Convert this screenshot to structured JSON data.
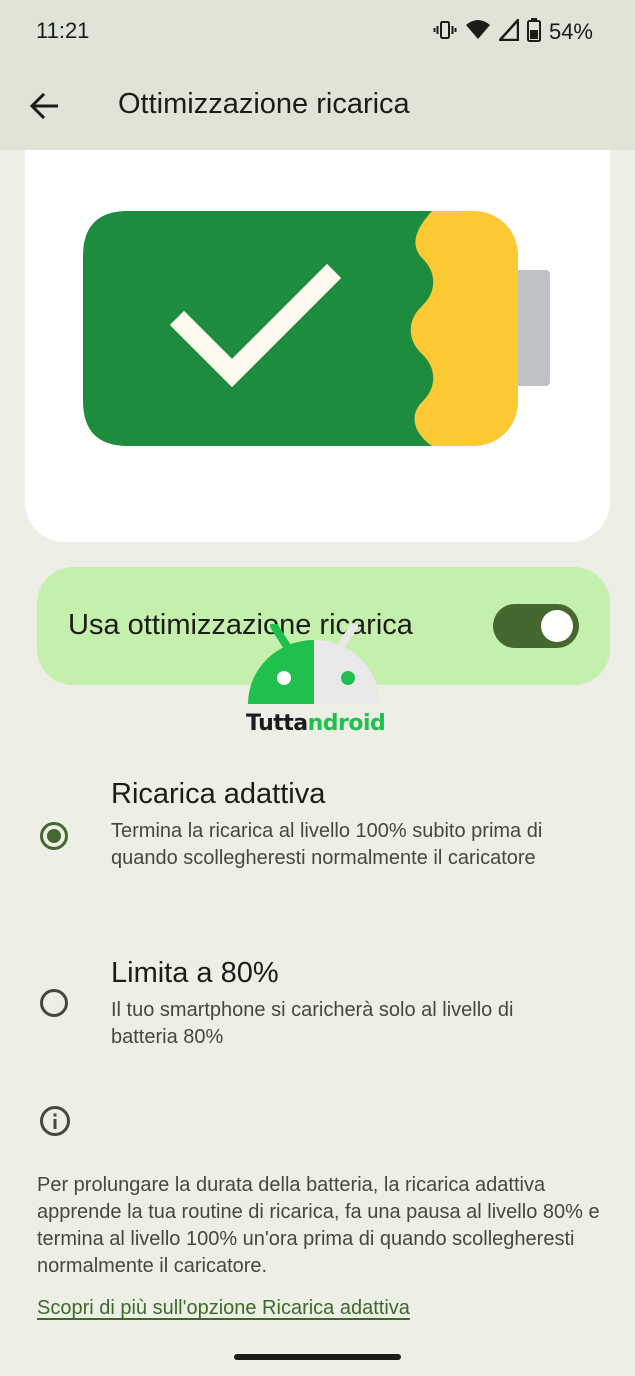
{
  "status_bar": {
    "time": "11:21",
    "battery_percent": "54%",
    "icons": [
      "vibrate-icon",
      "wifi-icon",
      "signal-icon",
      "battery-icon"
    ]
  },
  "app_bar": {
    "title": "Ottimizzazione ricarica",
    "back_icon": "arrow-back-icon"
  },
  "illustration": {
    "icon": "battery-check-illustration",
    "colors": {
      "green": "#1e8c3f",
      "yellow": "#fcc934",
      "terminal": "#bec1c6",
      "check": "#fdf9ee"
    }
  },
  "main_toggle": {
    "label": "Usa ottimizzazione ricarica",
    "state": "on"
  },
  "watermark": {
    "part1": "Tutta",
    "part2": "ndroid"
  },
  "options": [
    {
      "title": "Ricarica adattiva",
      "description": "Termina la ricarica al livello 100% subito prima di quando scollegheresti normalmente il caricatore",
      "selected": true
    },
    {
      "title": "Limita a 80%",
      "description": "Il tuo smartphone si caricherà solo al livello di batteria 80%",
      "selected": false
    }
  ],
  "info": {
    "icon": "info-icon",
    "text": "Per prolungare la durata della batteria, la ricarica adattiva apprende la tua routine di ricarica, fa una pausa al livello 80% e termina al livello 100% un'ora prima di quando scollegheresti normalmente il caricatore.",
    "link": "Scopri di più sull'opzione Ricarica adattiva"
  },
  "theme": {
    "accent": "#476731",
    "toggle_card_bg": "#c4efad",
    "background": "#edeee5"
  }
}
